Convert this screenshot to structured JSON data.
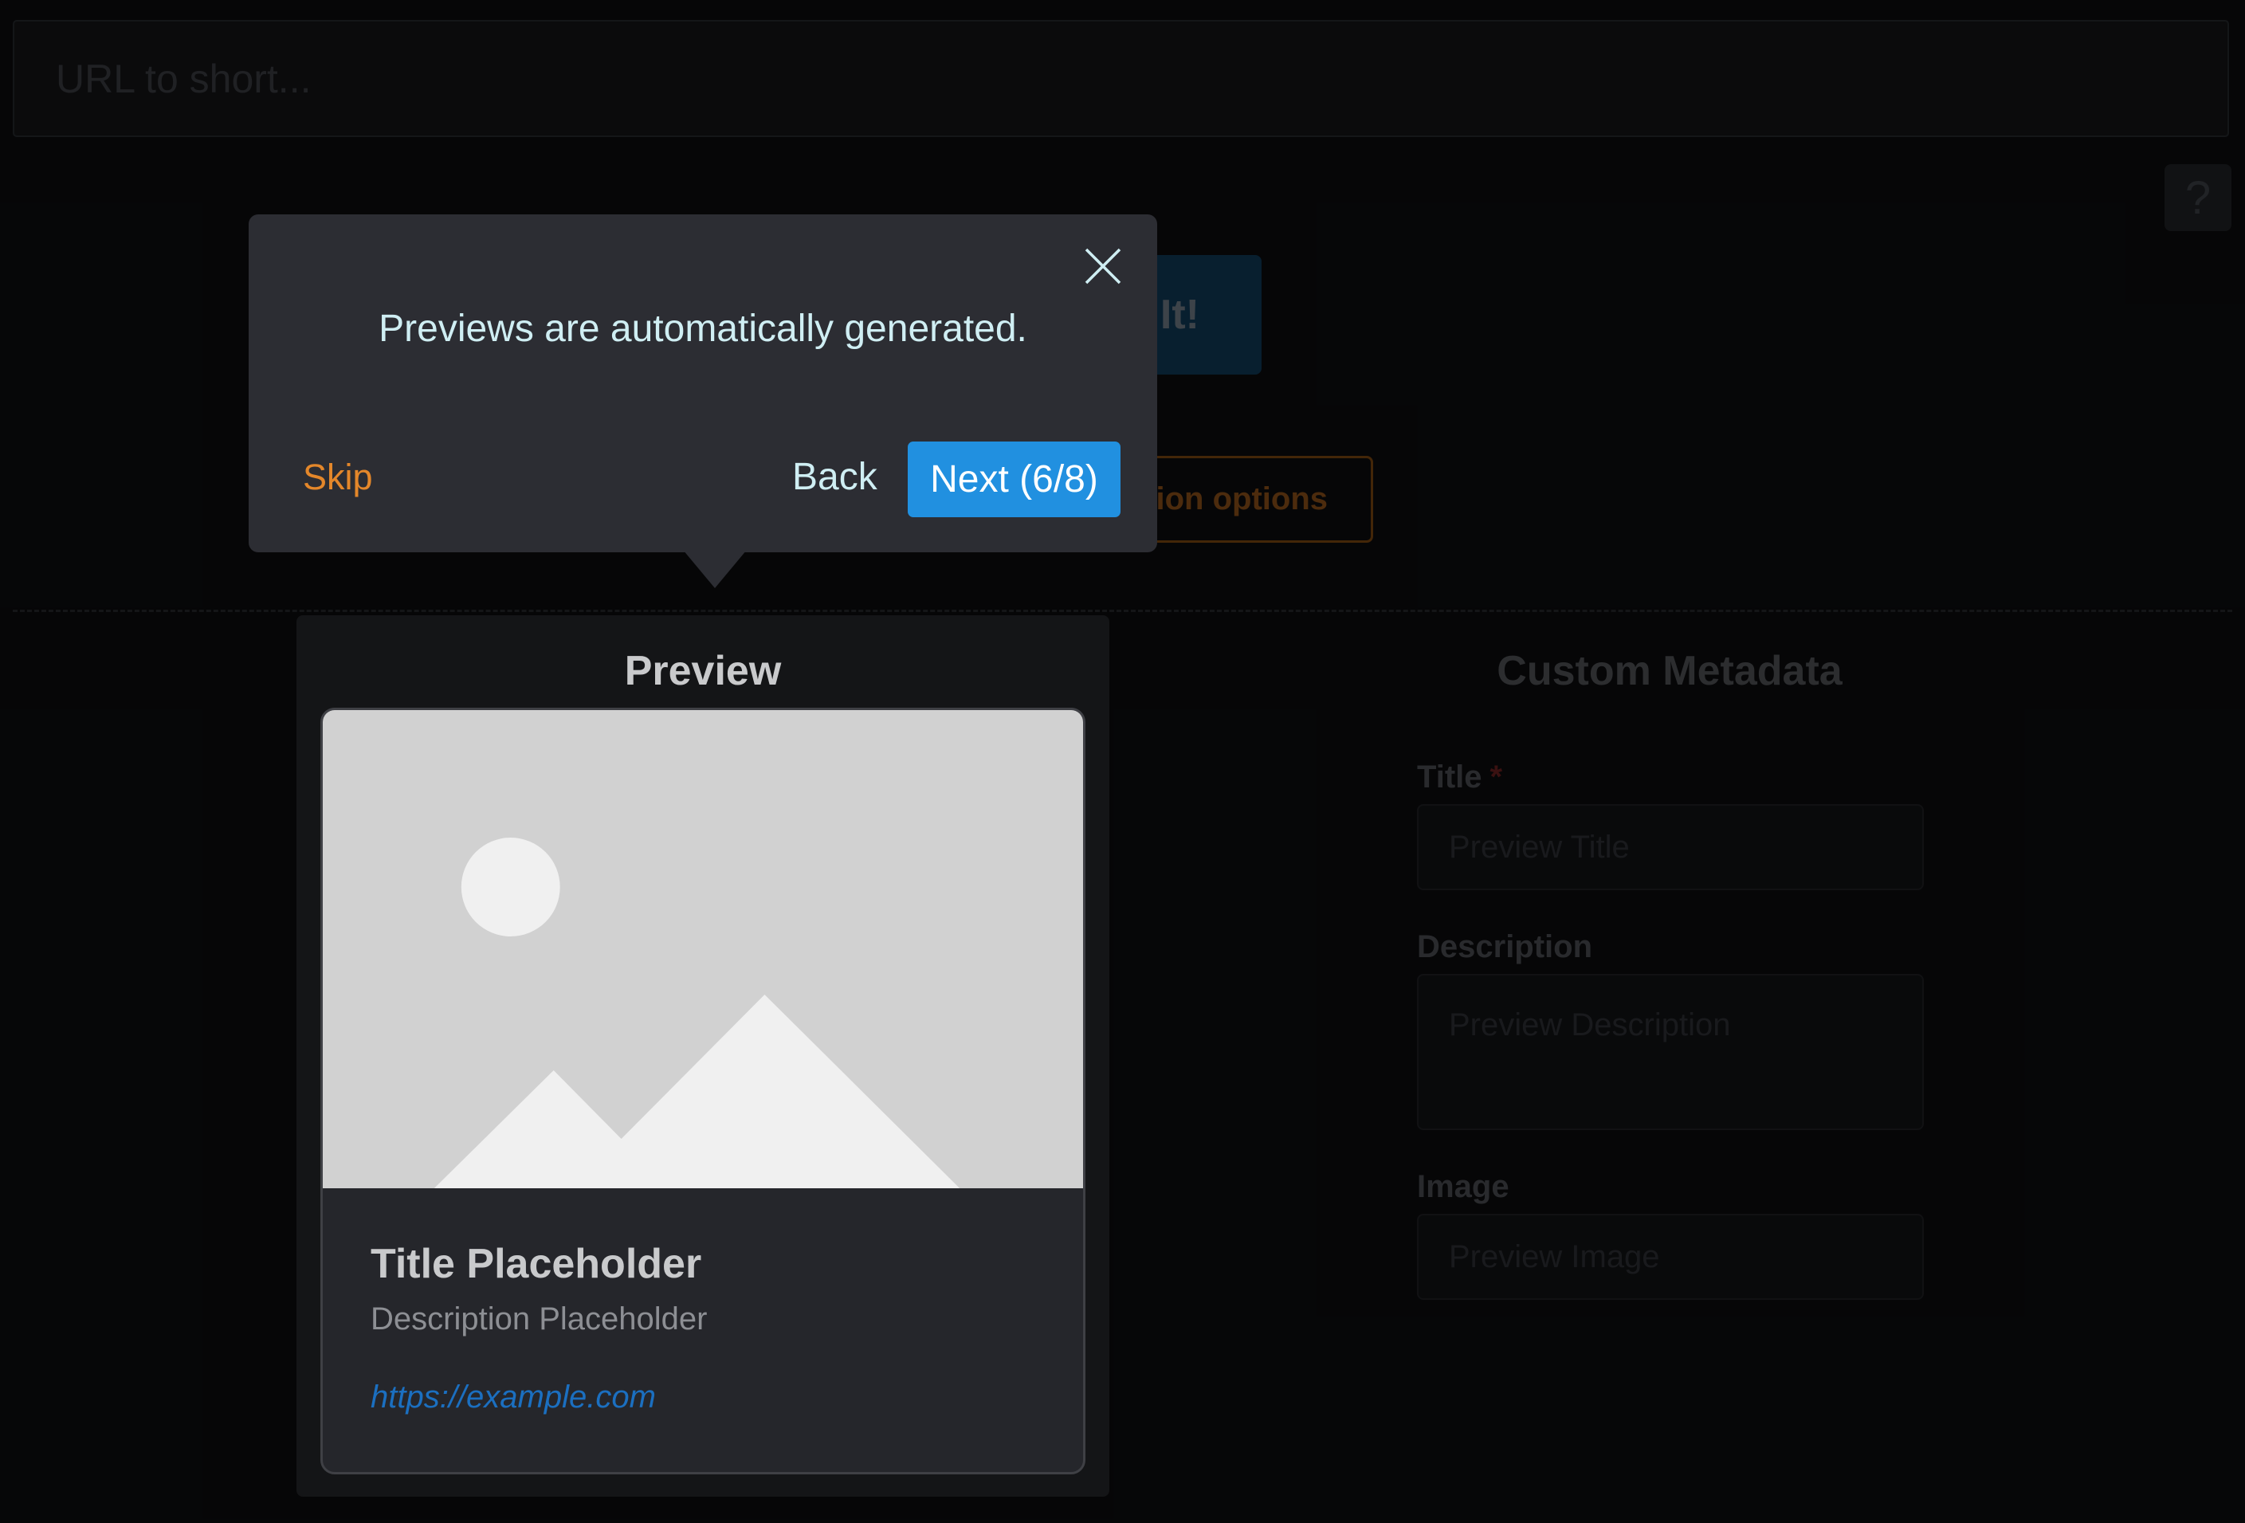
{
  "url_input": {
    "placeholder": "URL to short..."
  },
  "help": {
    "label": "?"
  },
  "shorten_button": {
    "label": "It!"
  },
  "advanced_button": {
    "label": "tion options"
  },
  "preview": {
    "heading": "Preview",
    "card": {
      "image_icon": "image-placeholder-icon",
      "title": "Title Placeholder",
      "description": "Description Placeholder",
      "url": "https://example.com"
    }
  },
  "custom_metadata": {
    "heading": "Custom Metadata",
    "fields": {
      "title": {
        "label": "Title",
        "required_marker": "*",
        "placeholder": "Preview Title"
      },
      "description": {
        "label": "Description",
        "placeholder": "Preview Description"
      },
      "image": {
        "label": "Image",
        "placeholder": "Preview Image"
      }
    }
  },
  "tour": {
    "message": "Previews are automatically generated.",
    "close_icon": "close-icon",
    "skip_label": "Skip",
    "back_label": "Back",
    "next_label": "Next (6/8)"
  },
  "colors": {
    "background": "#0b0c0e",
    "popover": "#2c2d33",
    "accent_blue": "#2190e0",
    "accent_orange": "#e4872a",
    "link": "#1b6fc0"
  }
}
